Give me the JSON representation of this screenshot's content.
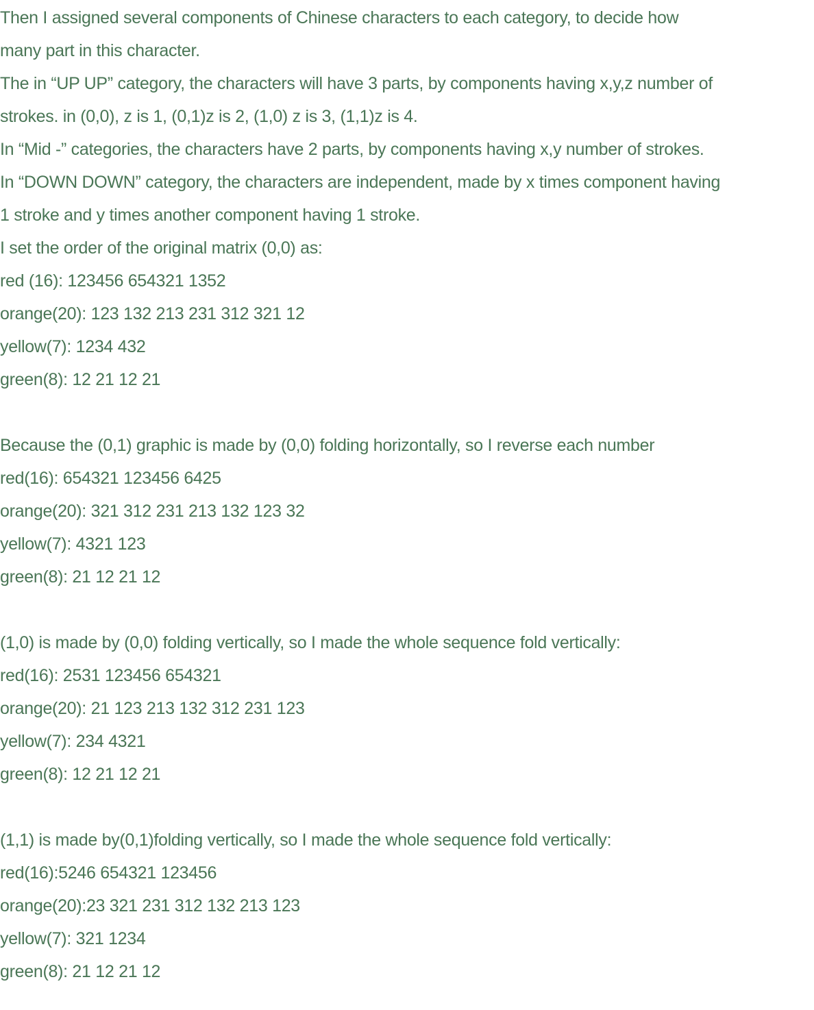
{
  "theme": {
    "text_color": "#4a7656",
    "background": "#ffffff"
  },
  "intro": [
    "Then I assigned several components of Chinese characters to each category, to decide how",
    "many part in this character.",
    "The in “UP UP” category, the characters will have 3 parts, by components having x,y,z number of",
    "strokes. in (0,0), z is 1, (0,1)z is 2, (1,0) z is 3, (1,1)z is 4.",
    "In “Mid -” categories, the characters have 2 parts, by components having x,y number of strokes.",
    "In “DOWN DOWN” category, the characters are independent, made by x times component having",
    "1 stroke and y times another component having 1 stroke."
  ],
  "sections": [
    {
      "heading": "I set the order of the original matrix (0,0) as:",
      "rows": [
        "red (16): 123456 654321 1352",
        "orange(20): 123 132 213 231 312 321 12",
        "yellow(7): 1234 432",
        "green(8): 12 21 12 21"
      ]
    },
    {
      "heading": "Because the (0,1) graphic is made by (0,0) folding horizontally, so I reverse each number",
      "rows": [
        "red(16): 654321 123456 6425",
        "orange(20): 321 312 231 213 132 123 32",
        "yellow(7): 4321 123",
        "green(8): 21 12 21 12"
      ]
    },
    {
      "heading": "(1,0) is made by (0,0) folding vertically, so I made the whole sequence fold vertically:",
      "rows": [
        "red(16): 2531 123456 654321",
        "orange(20): 21 123 213 132 312 231 123",
        "yellow(7): 234 4321",
        "green(8): 12 21 12 21"
      ]
    },
    {
      "heading": "(1,1) is made by(0,1)folding vertically, so I made the whole sequence fold vertically:",
      "rows": [
        "red(16):5246 654321 123456",
        "orange(20):23 321 231 312 132 213 123",
        "yellow(7): 321 1234",
        "green(8): 21 12 21 12"
      ]
    }
  ]
}
